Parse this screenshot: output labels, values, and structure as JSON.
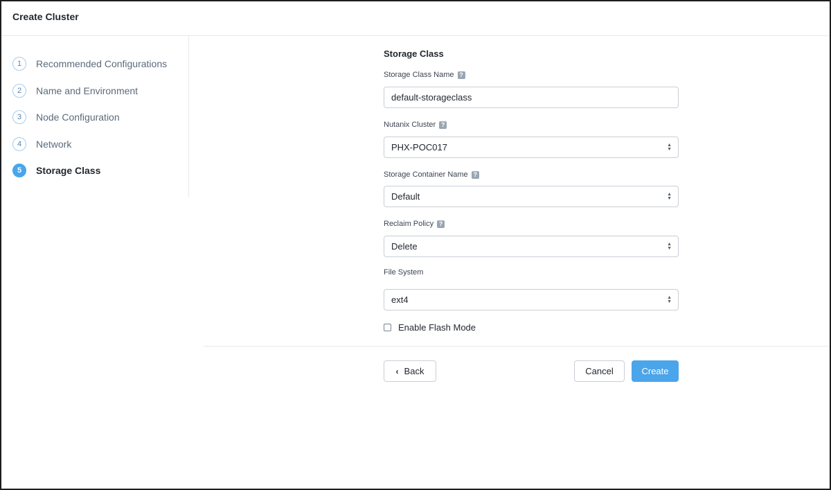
{
  "window": {
    "title": "Create Cluster"
  },
  "steps": [
    {
      "number": "1",
      "label": "Recommended Configurations"
    },
    {
      "number": "2",
      "label": "Name and Environment"
    },
    {
      "number": "3",
      "label": "Node Configuration"
    },
    {
      "number": "4",
      "label": "Network"
    },
    {
      "number": "5",
      "label": "Storage Class",
      "active": true
    }
  ],
  "form": {
    "section_title": "Storage Class",
    "storage_class_name": {
      "label": "Storage Class Name",
      "value": "default-storageclass"
    },
    "nutanix_cluster": {
      "label": "Nutanix Cluster",
      "value": "PHX-POC017"
    },
    "storage_container_name": {
      "label": "Storage Container Name",
      "value": "Default"
    },
    "reclaim_policy": {
      "label": "Reclaim Policy",
      "value": "Delete"
    },
    "file_system": {
      "label": "File System",
      "value": "ext4"
    },
    "flash_mode": {
      "label": "Enable Flash Mode",
      "checked": false
    },
    "help_icon_glyph": "?"
  },
  "footer": {
    "back_label": "Back",
    "cancel_label": "Cancel",
    "create_label": "Create"
  },
  "colors": {
    "accent": "#4ba5ea",
    "border": "#c9ced6"
  }
}
